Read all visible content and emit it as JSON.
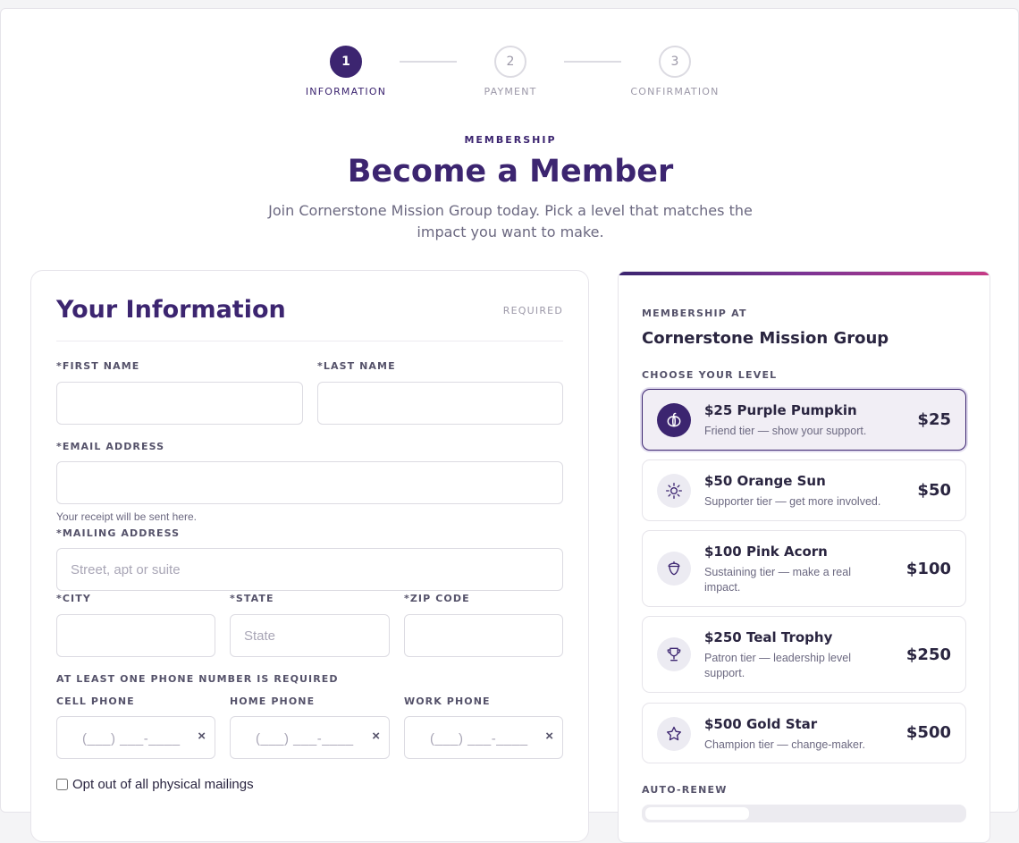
{
  "stepper": {
    "steps": [
      {
        "number": "1",
        "label": "INFORMATION",
        "active": true
      },
      {
        "number": "2",
        "label": "PAYMENT",
        "active": false
      },
      {
        "number": "3",
        "label": "CONFIRMATION",
        "active": false
      }
    ]
  },
  "hero": {
    "eyebrow": "MEMBERSHIP",
    "title": "Become a Member",
    "subtitle": "Join Cornerstone Mission Group today. Pick a level that matches the impact you want to make."
  },
  "form": {
    "title": "Your Information",
    "required_label": "REQUIRED",
    "first_name_label": "*FIRST NAME",
    "last_name_label": "*LAST NAME",
    "email_label": "*EMAIL ADDRESS",
    "email_hint": "Your receipt will be sent here.",
    "mailing_label": "*MAILING ADDRESS",
    "mailing_placeholder": "Street, apt or suite",
    "city_label": "*CITY",
    "state_label": "*STATE",
    "state_placeholder": "State",
    "zip_label": "*ZIP CODE",
    "phone_note": "AT LEAST ONE PHONE NUMBER IS REQUIRED",
    "cell_label": "CELL PHONE",
    "home_label": "HOME PHONE",
    "work_label": "WORK PHONE",
    "phone_mask": "(___) ___-____",
    "clear_glyph": "×",
    "opt_out_label": "Opt out of all physical mailings"
  },
  "membership": {
    "eyebrow": "MEMBERSHIP AT",
    "org": "Cornerstone Mission Group",
    "choose_label": "CHOOSE YOUR LEVEL",
    "levels": [
      {
        "name": "$25 Purple Pumpkin",
        "desc": "Friend tier — show your support.",
        "price": "$25",
        "icon": "pumpkin-icon",
        "selected": true
      },
      {
        "name": "$50 Orange Sun",
        "desc": "Supporter tier — get more involved.",
        "price": "$50",
        "icon": "sun-icon",
        "selected": false
      },
      {
        "name": "$100 Pink Acorn",
        "desc": "Sustaining tier — make a real impact.",
        "price": "$100",
        "icon": "acorn-icon",
        "selected": false
      },
      {
        "name": "$250 Teal Trophy",
        "desc": "Patron tier — leadership level support.",
        "price": "$250",
        "icon": "trophy-icon",
        "selected": false
      },
      {
        "name": "$500 Gold Star",
        "desc": "Champion tier — change-maker.",
        "price": "$500",
        "icon": "star-icon",
        "selected": false
      }
    ],
    "auto_renew_label": "AUTO-RENEW"
  },
  "colors": {
    "primary": "#3c2570",
    "accent_gradient_end": "#c63a86",
    "muted_text": "#6b6880",
    "border": "#e6e4ea"
  }
}
